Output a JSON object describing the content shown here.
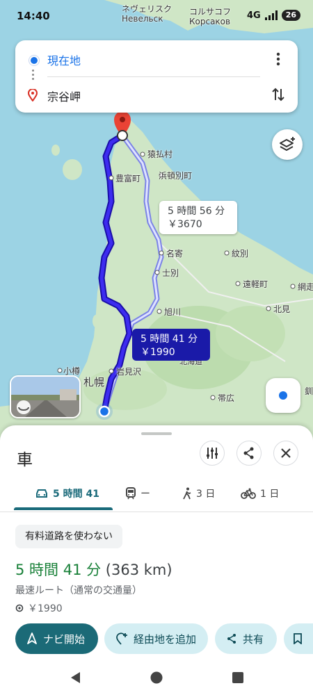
{
  "status_bar": {
    "time": "14:40",
    "network": "4G",
    "battery": "26"
  },
  "map": {
    "labels": {
      "top_city1_jp": "ネヴェリスク",
      "top_city1_ru": "Невельск",
      "top_city2_jp": "コルサコフ",
      "top_city2_ru": "Корсаков",
      "sarufutsu": "猿払村",
      "hamatonbetsu": "浜頓別町",
      "toyotomi": "豊富町",
      "nayoro": "名寄",
      "monbetsu": "紋別",
      "shibetsu": "士別",
      "engaru": "遠軽町",
      "abashiri": "網走",
      "asahikawa": "旭川",
      "kitami": "北見",
      "iwamizawa": "岩見沢",
      "otaru": "小樽",
      "sapporo": "札幌",
      "obihiro": "帯広",
      "kushiro": "釧",
      "hokkaido_route": "北海道"
    },
    "route_bubbles": {
      "alternate": {
        "time": "5 時間 56 分",
        "cost": "￥3670"
      },
      "selected": {
        "time": "5 時間 41 分",
        "cost": "￥1990"
      }
    },
    "icons": [
      "layers-icon",
      "my-location-icon",
      "street-view-thumbnail"
    ],
    "colors": {
      "land": "#cfe6c6",
      "water": "#9cd3e4",
      "route_main": "#2c1cd4",
      "route_alt": "#a6b0f5"
    }
  },
  "search": {
    "origin": "現在地",
    "destination": "宗谷岬",
    "icons": [
      "origin-dot-icon",
      "destination-pin-icon",
      "more-vert-icon",
      "swap-icon"
    ]
  },
  "sheet": {
    "title": "車",
    "buttons": [
      "tune-icon",
      "share-icon",
      "close-icon"
    ],
    "tabs": [
      {
        "icon": "car-icon",
        "label": "5 時間 41"
      },
      {
        "icon": "train-icon",
        "label": "ー"
      },
      {
        "icon": "walk-icon",
        "label": "3 日"
      },
      {
        "icon": "bike-icon",
        "label": "1 日"
      }
    ],
    "chip": "有料道路を使わない",
    "duration": "5 時間 41 分",
    "distance": "(363 km)",
    "route_note": "最速ルート（通常の交通量）",
    "toll": "￥1990",
    "actions": {
      "start": "ナビ開始",
      "add_stop": "経由地を追加",
      "share": "共有"
    }
  },
  "nav_bar": [
    "back-icon",
    "home-icon",
    "recents-icon"
  ]
}
